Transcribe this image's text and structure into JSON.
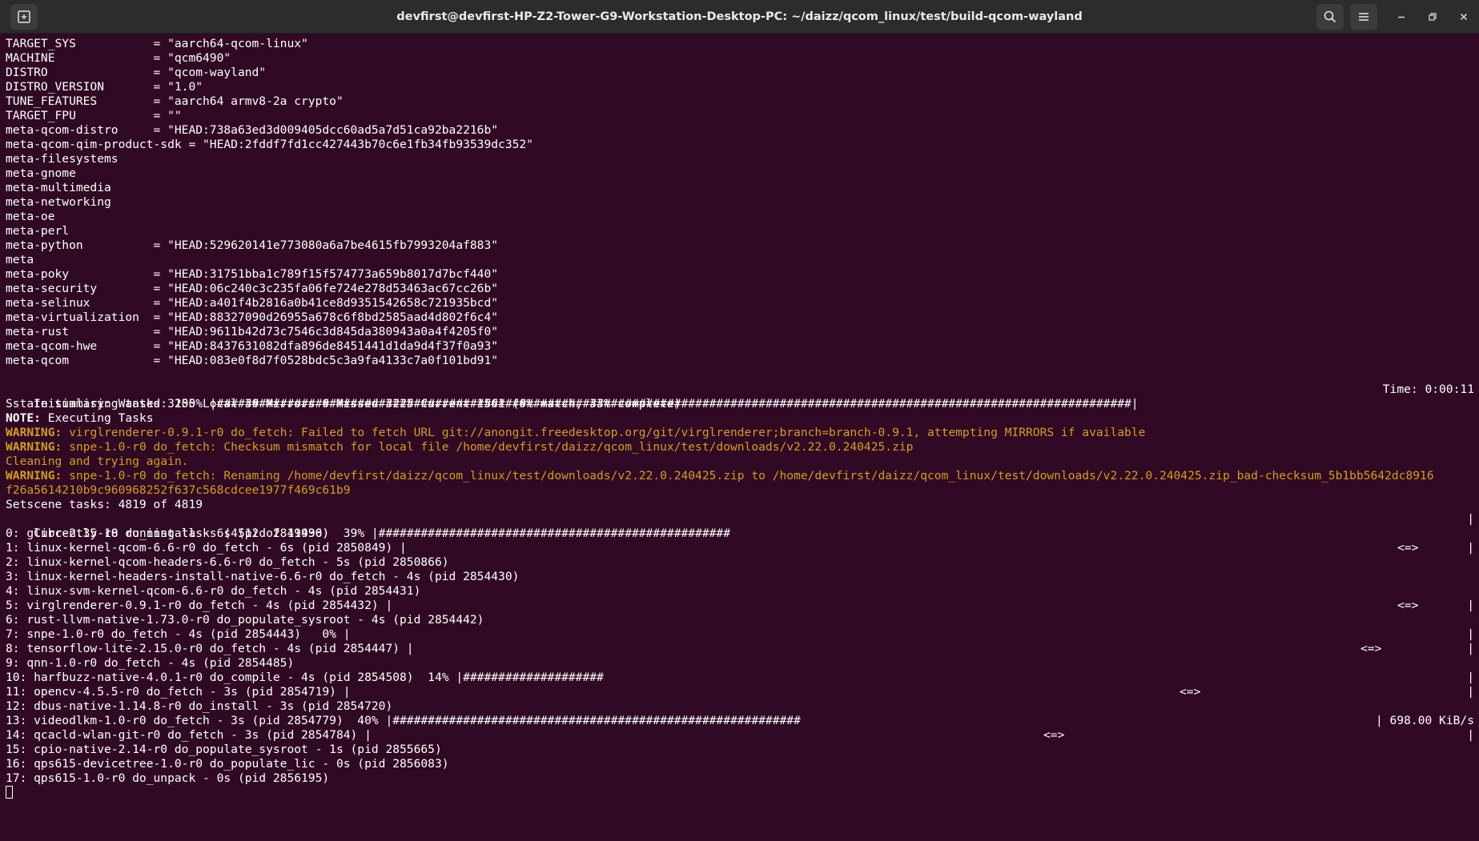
{
  "window": {
    "title": "devfirst@devfirst-HP-Z2-Tower-G9-Workstation-Desktop-PC: ~/daizz/qcom_linux/test/build-qcom-wayland",
    "new_tab_icon": "new-tab-icon",
    "search_icon": "search-icon",
    "menu_icon": "hamburger-menu-icon"
  },
  "colors": {
    "background": "#300a24",
    "titlebar": "#2c2c2c",
    "text": "#ffffff",
    "warning": "#d29e1c"
  },
  "config_lines": [
    "TARGET_SYS           = \"aarch64-qcom-linux\"",
    "MACHINE              = \"qcm6490\"",
    "DISTRO               = \"qcom-wayland\"",
    "DISTRO_VERSION       = \"1.0\"",
    "TUNE_FEATURES        = \"aarch64 armv8-2a crypto\"",
    "TARGET_FPU           = \"\"",
    "meta-qcom-distro     = \"HEAD:738a63ed3d009405dcc60ad5a7d51ca92ba2216b\"",
    "meta-qcom-qim-product-sdk = \"HEAD:2fddf7fd1cc427443b70c6e1fb34fb93539dc352\"",
    "meta-filesystems",
    "meta-gnome",
    "meta-multimedia",
    "meta-networking",
    "meta-oe",
    "meta-perl",
    "meta-python          = \"HEAD:529620141e773080a6a7be4615fb7993204af883\"",
    "meta",
    "meta-poky            = \"HEAD:31751bba1c789f15f574773a659b8017d7bcf440\"",
    "meta-security        = \"HEAD:06c240c3c235fa06fe724e278d53463ac67cc26b\"",
    "meta-selinux         = \"HEAD:a401f4b2816a0b41ce8d9351542658c721935bcd\"",
    "meta-virtualization  = \"HEAD:88327090d26955a678c6f8bd2585aad4d802f6c4\"",
    "meta-rust            = \"HEAD:9611b42d73c7546c3d845da380943a0a4f4205f0\"",
    "meta-qcom-hwe        = \"HEAD:8437631082dfa896de8451441d1da9d4f37f0a93\"",
    "meta-qcom            = \"HEAD:083e0f8d7f0528bdc5c3a9fa4133c7a0f101bd91\""
  ],
  "init": {
    "text": "Initialising tasks: 100% |##################################################################################################################################|",
    "time": "Time: 0:00:11"
  },
  "sstate": "Sstate summary: Wanted 3255 Local 30 Mirrors 0 Missed 3225 Current 1561 (0% match, 33% complete)",
  "note": {
    "label": "NOTE:",
    "text": " Executing Tasks"
  },
  "warnings": [
    {
      "label": "WARNING:",
      "text": " virglrenderer-0.9.1-r0 do_fetch: Failed to fetch URL git://anongit.freedesktop.org/git/virglrenderer;branch=branch-0.9.1, attempting MIRRORS if available"
    },
    {
      "label": "WARNING:",
      "text": " snpe-1.0-r0 do_fetch: Checksum mismatch for local file /home/devfirst/daizz/qcom_linux/test/downloads/v2.22.0.240425.zip"
    }
  ],
  "cleaning": "Cleaning and trying again.",
  "warning3": {
    "label": "WARNING:",
    "text": " snpe-1.0-r0 do_fetch: Renaming /home/devfirst/daizz/qcom_linux/test/downloads/v2.22.0.240425.zip to /home/devfirst/daizz/qcom_linux/test/downloads/v2.22.0.240425.zip_bad-checksum_5b1bb5642dc8916",
    "cont": "f26a5614210b9c960968252f637c568cdcee1977f469c61b9"
  },
  "setscene": "Setscene tasks: 4819 of 4819",
  "running": {
    "text": "Currently 18 running tasks (4512 of 11490)  39% |##################################################",
    "end": "|"
  },
  "tasks": [
    {
      "text": "0: glibc-2.35-r0 do_install - 6s (pid 2849936)",
      "mid": "",
      "end": ""
    },
    {
      "text": "1: linux-kernel-qcom-6.6-r0 do_fetch - 6s (pid 2850849) |",
      "mid": "<=>",
      "end": "|"
    },
    {
      "text": "2: linux-kernel-qcom-headers-6.6-r0 do_fetch - 5s (pid 2850866)",
      "mid": "",
      "end": ""
    },
    {
      "text": "3: linux-kernel-headers-install-native-6.6-r0 do_fetch - 4s (pid 2854430)",
      "mid": "",
      "end": ""
    },
    {
      "text": "4: linux-svm-kernel-qcom-6.6-r0 do_fetch - 4s (pid 2854431)",
      "mid": "",
      "end": ""
    },
    {
      "text": "5: virglrenderer-0.9.1-r0 do_fetch - 4s (pid 2854432) |",
      "mid": "<=>",
      "end": "|"
    },
    {
      "text": "6: rust-llvm-native-1.73.0-r0 do_populate_sysroot - 4s (pid 2854442)",
      "mid": "",
      "end": ""
    },
    {
      "text": "7: snpe-1.0-r0 do_fetch - 4s (pid 2854443)   0% |",
      "mid": "",
      "end": "|"
    },
    {
      "text": "8: tensorflow-lite-2.15.0-r0 do_fetch - 4s (pid 2854447) |",
      "mid": "<=>",
      "end": "|"
    },
    {
      "text": "9: qnn-1.0-r0 do_fetch - 4s (pid 2854485)",
      "mid": "",
      "end": ""
    },
    {
      "text": "10: harfbuzz-native-4.0.1-r0 do_compile - 4s (pid 2854508)  14% |####################",
      "mid": "",
      "end": "|"
    },
    {
      "text": "11: opencv-4.5.5-r0 do_fetch - 3s (pid 2854719) |",
      "mid": "<=>",
      "end": "|"
    },
    {
      "text": "12: dbus-native-1.14.8-r0 do_install - 3s (pid 2854720)",
      "mid": "",
      "end": ""
    },
    {
      "text": "13: videodlkm-1.0-r0 do_fetch - 3s (pid 2854779)  40% |##########################################################",
      "mid": "",
      "end": "| 698.00 KiB/s"
    },
    {
      "text": "14: qcacld-wlan-git-r0 do_fetch - 3s (pid 2854784) |",
      "mid": "<=>",
      "end": "|"
    },
    {
      "text": "15: cpio-native-2.14-r0 do_populate_sysroot - 1s (pid 2855665)",
      "mid": "",
      "end": ""
    },
    {
      "text": "16: qps615-devicetree-1.0-r0 do_populate_lic - 0s (pid 2856083)",
      "mid": "",
      "end": ""
    },
    {
      "text": "17: qps615-1.0-r0 do_unpack - 0s (pid 2856195)",
      "mid": "",
      "end": ""
    }
  ]
}
